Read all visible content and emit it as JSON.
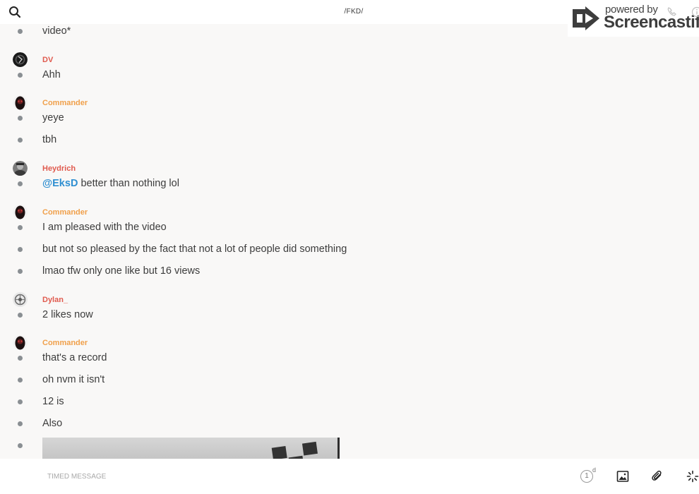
{
  "header": {
    "channel_title": "/FKD/"
  },
  "watermark": {
    "small_text": "powered by",
    "brand_text": "Screencastify"
  },
  "messages": [
    {
      "type": "text",
      "text": "video*"
    },
    {
      "type": "author",
      "name": "DV",
      "color": "#e05a4e"
    },
    {
      "type": "text",
      "text": "Ahh"
    },
    {
      "type": "author",
      "name": "Commander",
      "color": "#f0a04b"
    },
    {
      "type": "text",
      "text": "yeye"
    },
    {
      "type": "text",
      "text": "tbh"
    },
    {
      "type": "author",
      "name": "Heydrich",
      "color": "#e05a4e"
    },
    {
      "type": "mention",
      "mention": "@EksD",
      "text": " better than nothing lol"
    },
    {
      "type": "author",
      "name": "Commander",
      "color": "#f0a04b"
    },
    {
      "type": "text",
      "text": "I am pleased with the video"
    },
    {
      "type": "text",
      "text": "but not so pleased by the fact that not a lot of people did something"
    },
    {
      "type": "text",
      "text": "lmao tfw only one like but 16 views"
    },
    {
      "type": "author",
      "name": "Dylan_",
      "color": "#e05a4e"
    },
    {
      "type": "text",
      "text": "2 likes now"
    },
    {
      "type": "author",
      "name": "Commander",
      "color": "#f0a04b"
    },
    {
      "type": "text",
      "text": "that's a record"
    },
    {
      "type": "text",
      "text": "oh nvm it isn't"
    },
    {
      "type": "text",
      "text": "12 is"
    },
    {
      "type": "text",
      "text": "Also"
    },
    {
      "type": "image"
    }
  ],
  "composer": {
    "placeholder": "TIMED MESSAGE",
    "timer_value": "1",
    "timer_unit": "d"
  },
  "colors": {
    "mention": "#2f8fd1",
    "bullet": "#8a8f93",
    "background": "#f9f8f7"
  }
}
